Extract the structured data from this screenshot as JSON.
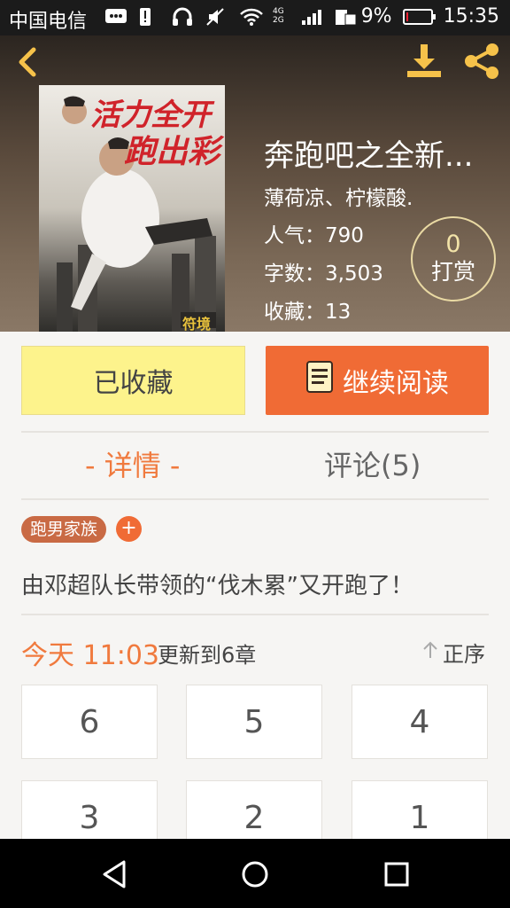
{
  "status_bar": {
    "carrier": "中国电信",
    "signal_label": "4G\n2G",
    "battery_percent": "9%",
    "battery_level": 0.09,
    "time": "15:35",
    "icons": [
      "message-icon",
      "alert-icon",
      "headphones-icon",
      "mute-icon",
      "wifi-icon",
      "signal-icon",
      "sim-icon",
      "battery-icon"
    ]
  },
  "header": {
    "back_icon": "chevron-left-icon",
    "download_icon": "download-icon",
    "share_icon": "share-icon",
    "cover_text": [
      "活力全开",
      "跑出彩"
    ],
    "cover_stamp": "符境"
  },
  "book": {
    "title": "奔跑吧之全新...",
    "author": "薄荷凉、柠檬酸.",
    "popularity": "人气：790",
    "word_count": "字数：3,503",
    "favorites": "收藏：13"
  },
  "reward": {
    "count": "0",
    "label": "打赏"
  },
  "actions": {
    "collected_label": "已收藏",
    "continue_label": "继续阅读",
    "book_icon": "book-icon"
  },
  "tabs": {
    "details": "- 详情 -",
    "comments": "评论(5)"
  },
  "tags": {
    "items": [
      "跑男家族"
    ],
    "add_label": "+"
  },
  "description": "由邓超队长带领的“伐木累”又开跑了！",
  "update": {
    "time": "今天 11:03",
    "text": "更新到6章",
    "sort_label": "正序",
    "sort_icon": "arrow-up-icon"
  },
  "chapters": [
    "6",
    "5",
    "4",
    "3",
    "2",
    "1"
  ],
  "colors": {
    "accent": "#f06b35",
    "collected_bg": "#fdf38c",
    "tab_active": "#f07a3e"
  },
  "nav_bar": {
    "icons": [
      "back-triangle-icon",
      "home-circle-icon",
      "recents-square-icon"
    ]
  }
}
